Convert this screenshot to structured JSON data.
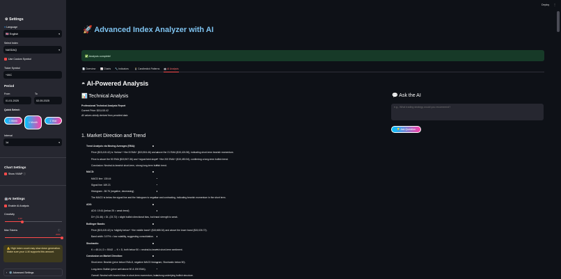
{
  "topbar": {
    "deploy": "Deploy",
    "menu": "⋮"
  },
  "sidebar": {
    "settings_title": "Settings",
    "language_label": "Language",
    "language_value": "🇬🇧 English",
    "index_label": "Select Index",
    "index_value": "NASDAQ",
    "custom_symbol_label": "Use Custom Symbol",
    "ticker_label": "Ticker Symbol",
    "ticker_value": "^IXIC",
    "period_title": "Period",
    "from_label": "From",
    "from_value": "01.01.2025",
    "to_label": "To",
    "to_value": "02.05.2025",
    "quick_select_label": "Quick Select:",
    "quick_buttons": [
      "1 Week",
      "1 Month",
      "1 Year"
    ],
    "interval_label": "Interval",
    "interval_value": "1d",
    "chart_settings_title": "Chart Settings",
    "show_vwap_label": "Show VWAP",
    "ai_settings_title": "AI Settings",
    "enable_ai_label": "Enable AI Analysis",
    "creativity_label": "Creativity",
    "creativity_value": "0.30",
    "creativity_level": 0.3,
    "max_tokens_label": "Max Tokens",
    "max_tokens_value": "2000",
    "max_tokens_level": 1.0,
    "warning_text": "⚠️ High token count may slow down generation. Make sure your LLM supports this amount.",
    "advanced_label": "⚙️ Advanced Settings"
  },
  "main": {
    "title": "Advanced Index Analyzer with AI",
    "success_text": "✅ Analysis complete!",
    "tabs": [
      "📄 Overview",
      "📈 Charts",
      "🔧 Indicators",
      "🕯️ Candlestick Patterns",
      "🤖 AI Analysis"
    ],
    "section_title": "AI-Powered Analysis",
    "tech_title": "Technical Analysis",
    "report_title": "Professional Technical Analysis Report",
    "current_price": "Current Price: $15,415.42",
    "all_values_note": "All values strictly derived from provided data",
    "market_title": "1. Market Direction and Trend",
    "lines": [
      {
        "text": "Trend Analysis via Moving Averages (EMA):",
        "bold": true,
        "indent": 0
      },
      {
        "text": "Price ($15,415.42) is +below+ +the 8 EMA+ ($15,504.46) and above the 21 EMA ($15,424.56), indicating short-term bearish momentum.",
        "indent": 1
      },
      {
        "text": "Price is above the 50 EMA ($15,967.36) and +signal faint slope+ +the 200 EMA+ ($15,450.54), confirming a long-term bullish trend.",
        "indent": 1
      },
      {
        "text": "Conclusion: Neutral-to-bearish short-term, strong long-term bullish trend.",
        "indent": 1
      },
      {
        "text": "MACD:",
        "bold": true,
        "indent": 0
      },
      {
        "text": "MACD line: 130.44",
        "indent": 1
      },
      {
        "text": "Signal line: 169.21",
        "indent": 1
      },
      {
        "text": "Histogram: -38.76 (negative, decreasing)",
        "indent": 1
      },
      {
        "text": "The MACD is below the signal line and the histogram is negative and contracting, indicating bearish momentum in the short term.",
        "indent": 1
      },
      {
        "text": "ADX:",
        "bold": true,
        "indent": 0
      },
      {
        "text": "ADX: 19.61 (below 25 = weak trend)",
        "indent": 1
      },
      {
        "text": "DI+ (31.46) > DI- (23.72) = slight bullish directional bias, but trend strength is weak.",
        "indent": 1
      },
      {
        "text": "Bollinger Bands:",
        "bold": true,
        "indent": 0
      },
      {
        "text": "Price ($15,415.42) is +slightly below+ +the middle band+ ($15,485.34) and above the lower band ($15,026.72).",
        "indent": 1
      },
      {
        "text": "Band width: 3.97% = low volatility, suggesting consolidation.",
        "indent": 1
      },
      {
        "text": "Stochastic:",
        "bold": true,
        "indent": 0
      },
      {
        "text": "K = 45.14, D = 55.62 → K < D, both below 50 = neutral-to-bearish short-term sentiment.",
        "indent": 1
      },
      {
        "text": "Conclusion on Market Direction:",
        "bold": true,
        "indent": 0
      },
      {
        "text": "Short-term: Bearish (price below EMA-8, negative MACD histogram, Stochastic below 50).",
        "indent": 1
      },
      {
        "text": "Long-term: Bullish (price well above 50 & 200 EMA).",
        "indent": 1
      },
      {
        "text": "Overall: Neutral with bearish bias in short-term momentum, but strong underlying bullish structure.",
        "indent": 1
      }
    ],
    "ask_title": "Ask the AI",
    "ask_placeholder": "e.g., What trading strategy would you recommend?",
    "ask_button": "💡 Ask Question"
  },
  "colors": {
    "accent": "#ff4b4b",
    "title": "#7ec3f0",
    "success_bg": "#173a28",
    "gradient_start": "#00c6ff",
    "gradient_end": "#ff3ea5"
  }
}
